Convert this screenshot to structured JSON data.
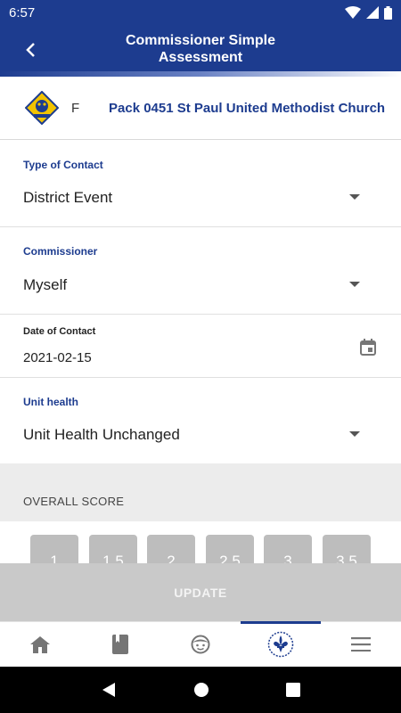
{
  "status_bar": {
    "time": "6:57"
  },
  "app_bar": {
    "title_line1": "Commissioner Simple",
    "title_line2": "Assessment"
  },
  "unit": {
    "letter": "F",
    "name": "Pack 0451 St Paul United Methodist Church"
  },
  "form": {
    "type_of_contact": {
      "label": "Type of Contact",
      "value": "District Event"
    },
    "commissioner": {
      "label": "Commissioner",
      "value": "Myself"
    },
    "date_of_contact": {
      "label": "Date of Contact",
      "value": "2021-02-15"
    },
    "unit_health": {
      "label": "Unit health",
      "value": "Unit Health Unchanged"
    }
  },
  "score": {
    "label": "OVERALL SCORE",
    "options": [
      "1",
      "1.5",
      "2",
      "2.5",
      "3",
      "3.5"
    ]
  },
  "update_label": "UPDATE",
  "colors": {
    "primary": "#1d3c8f",
    "disabled": "#c9c9c9"
  },
  "nav_icons": [
    "home-icon",
    "book-icon",
    "face-icon",
    "fleur-de-lis-icon",
    "menu-icon"
  ]
}
